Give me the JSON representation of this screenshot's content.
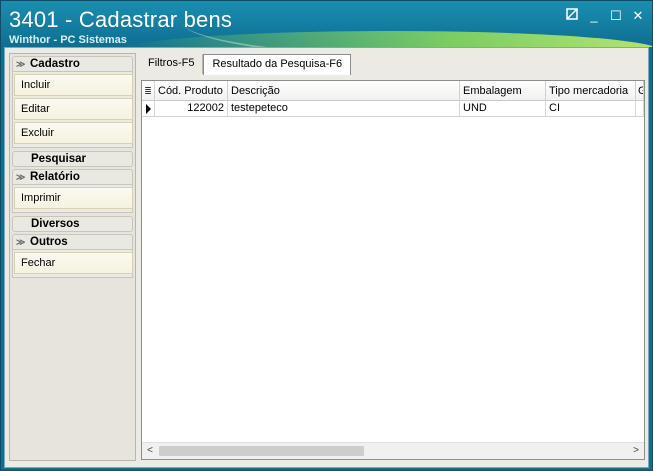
{
  "window": {
    "title": "3401 - Cadastrar bens",
    "subtitle": "Winthor - PC Sistemas",
    "controls": {
      "restore_icon": "restore-icon",
      "minimize_label": "_",
      "maximize_label": "☐",
      "close_label": "✕"
    }
  },
  "sidebar": {
    "groups": [
      {
        "title": "Cadastro",
        "items": [
          "Incluir",
          "Editar",
          "Excluir"
        ]
      },
      {
        "title": "Pesquisar",
        "collapsed": true
      },
      {
        "title": "Relatório",
        "items": [
          "Imprimir"
        ]
      },
      {
        "title": "Diversos",
        "collapsed": true
      },
      {
        "title": "Outros",
        "items": [
          "Fechar"
        ]
      }
    ]
  },
  "tabs": [
    {
      "label": "Filtros-F5",
      "active": false
    },
    {
      "label": "Resultado da Pesquisa-F6",
      "active": true
    }
  ],
  "grid": {
    "columns": [
      "Cód. Produto",
      "Descrição",
      "Embalagem",
      "Tipo mercadoria",
      "G"
    ],
    "rows": [
      {
        "codigo": "122002",
        "descricao": "testepeteco",
        "embalagem": "UND",
        "tipo": "CI",
        "g": ""
      }
    ],
    "indicator_icon": "row-selector-icon",
    "header_icon": "column-chooser-icon"
  },
  "colors": {
    "title_bar": "#1580a3",
    "accent_green": "#8cdc5a",
    "panel_bg": "#ecebe3"
  }
}
